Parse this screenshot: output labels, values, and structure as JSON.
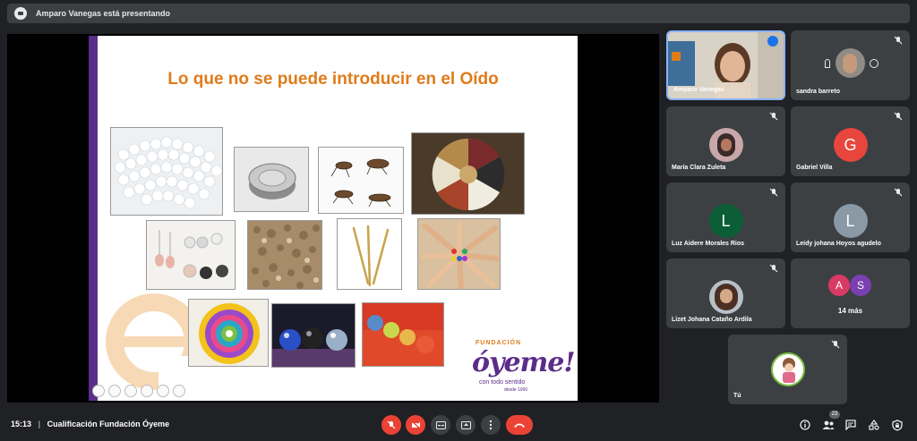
{
  "banner": {
    "text": "Amparo Vanegas está presentando"
  },
  "slide": {
    "title": "Lo que no se puede introducir en el Oído",
    "logo": {
      "fundacion": "FUNDACIÓN",
      "brand": "óyeme!",
      "tagline": "con todo sentido",
      "since": "desde 1966"
    }
  },
  "tiles": {
    "amparo": {
      "name": "Amparo Vanegas"
    },
    "sandra": {
      "name": "sandra barreto"
    },
    "maria": {
      "name": "María Clara Zuleta"
    },
    "gabriel": {
      "name": "Gabriel Villa",
      "initial": "G"
    },
    "luz": {
      "name": "Luz Aidere Morales Rios",
      "initial": "L"
    },
    "leidy": {
      "name": "Leidy johana Hoyos agudelo",
      "initial": "L"
    },
    "lizet": {
      "name": "Lizet Johana Cataño Ardila"
    },
    "more": {
      "label": "14 más",
      "initial_a": "A",
      "initial_s": "S"
    },
    "self": {
      "name": "Tú"
    }
  },
  "colors": {
    "gabriel": "#e8453c",
    "luz": "#0b5e36",
    "leidy": "#8a99a6",
    "a_avatar": "#d93a63",
    "s_avatar": "#7a3fb0"
  },
  "bottom": {
    "time": "15:13",
    "separator": "|",
    "meeting_title": "Cualificación Fundación Óyeme",
    "participants_count": "23"
  }
}
